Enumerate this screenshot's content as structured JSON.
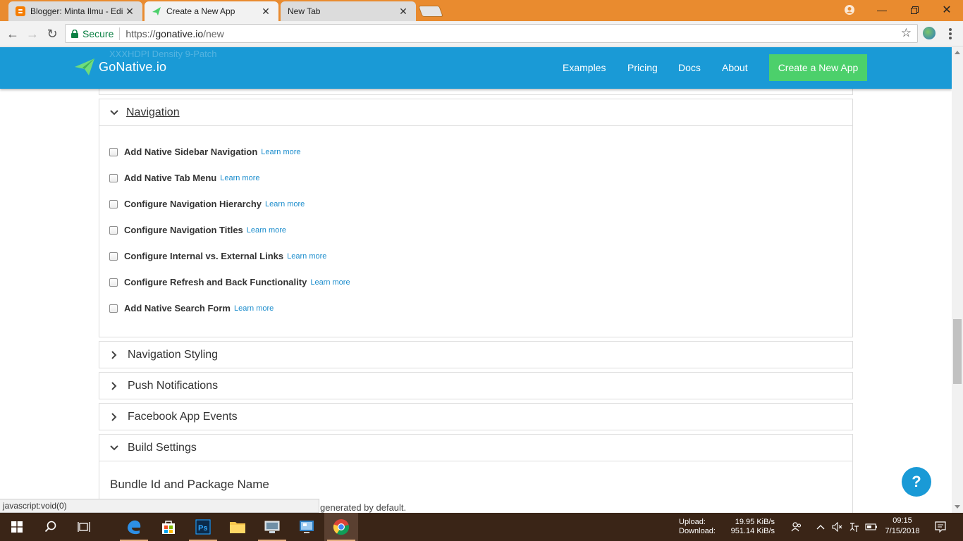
{
  "browser": {
    "tabs": [
      {
        "title": "Blogger: Minta Ilmu - Edi",
        "favicon": "blogger-icon",
        "state": "inactive"
      },
      {
        "title": "Create a New App",
        "favicon": "gonative-icon",
        "state": "active"
      },
      {
        "title": "New Tab",
        "favicon": "",
        "state": "inactive"
      }
    ],
    "security_label": "Secure",
    "url_scheme": "https://",
    "url_host": "gonative.io",
    "url_path": "/new",
    "status_bar": "javascript:void(0)"
  },
  "site": {
    "ghost_text": "XXXHDPI Density 9-Patch",
    "logo_text": "GoNative.io",
    "nav": [
      {
        "label": "Examples"
      },
      {
        "label": "Pricing"
      },
      {
        "label": "Docs"
      },
      {
        "label": "About"
      }
    ],
    "cta_label": "Create a New App",
    "help_label": "?",
    "brand_color": "#1a9ad6",
    "cta_color": "#4cd06b"
  },
  "navigation_panel": {
    "title": "Navigation",
    "expanded": true,
    "options": [
      {
        "label": "Add Native Sidebar Navigation",
        "link": "Learn more",
        "checked": false
      },
      {
        "label": "Add Native Tab Menu",
        "link": "Learn more",
        "checked": false
      },
      {
        "label": "Configure Navigation Hierarchy",
        "link": "Learn more",
        "checked": false
      },
      {
        "label": "Configure Navigation Titles",
        "link": "Learn more",
        "checked": false
      },
      {
        "label": "Configure Internal vs. External Links",
        "link": "Learn more",
        "checked": false
      },
      {
        "label": "Configure Refresh and Back Functionality",
        "link": "Learn more",
        "checked": false
      },
      {
        "label": "Add Native Search Form",
        "link": "Learn more",
        "checked": false
      }
    ]
  },
  "collapsed_panels": [
    {
      "title": "Navigation Styling"
    },
    {
      "title": "Push Notifications"
    },
    {
      "title": "Facebook App Events"
    }
  ],
  "build_settings": {
    "title": "Build Settings",
    "expanded": true,
    "bundle_heading": "Bundle Id and Package Name",
    "bundle_desc_partial": "generated by default."
  },
  "taskbar": {
    "upload_label": "Upload:",
    "upload_value": "19.95 KiB/s",
    "download_label": "Download:",
    "download_value": "951.14 KiB/s",
    "time": "09:15",
    "date": "7/15/2018"
  }
}
